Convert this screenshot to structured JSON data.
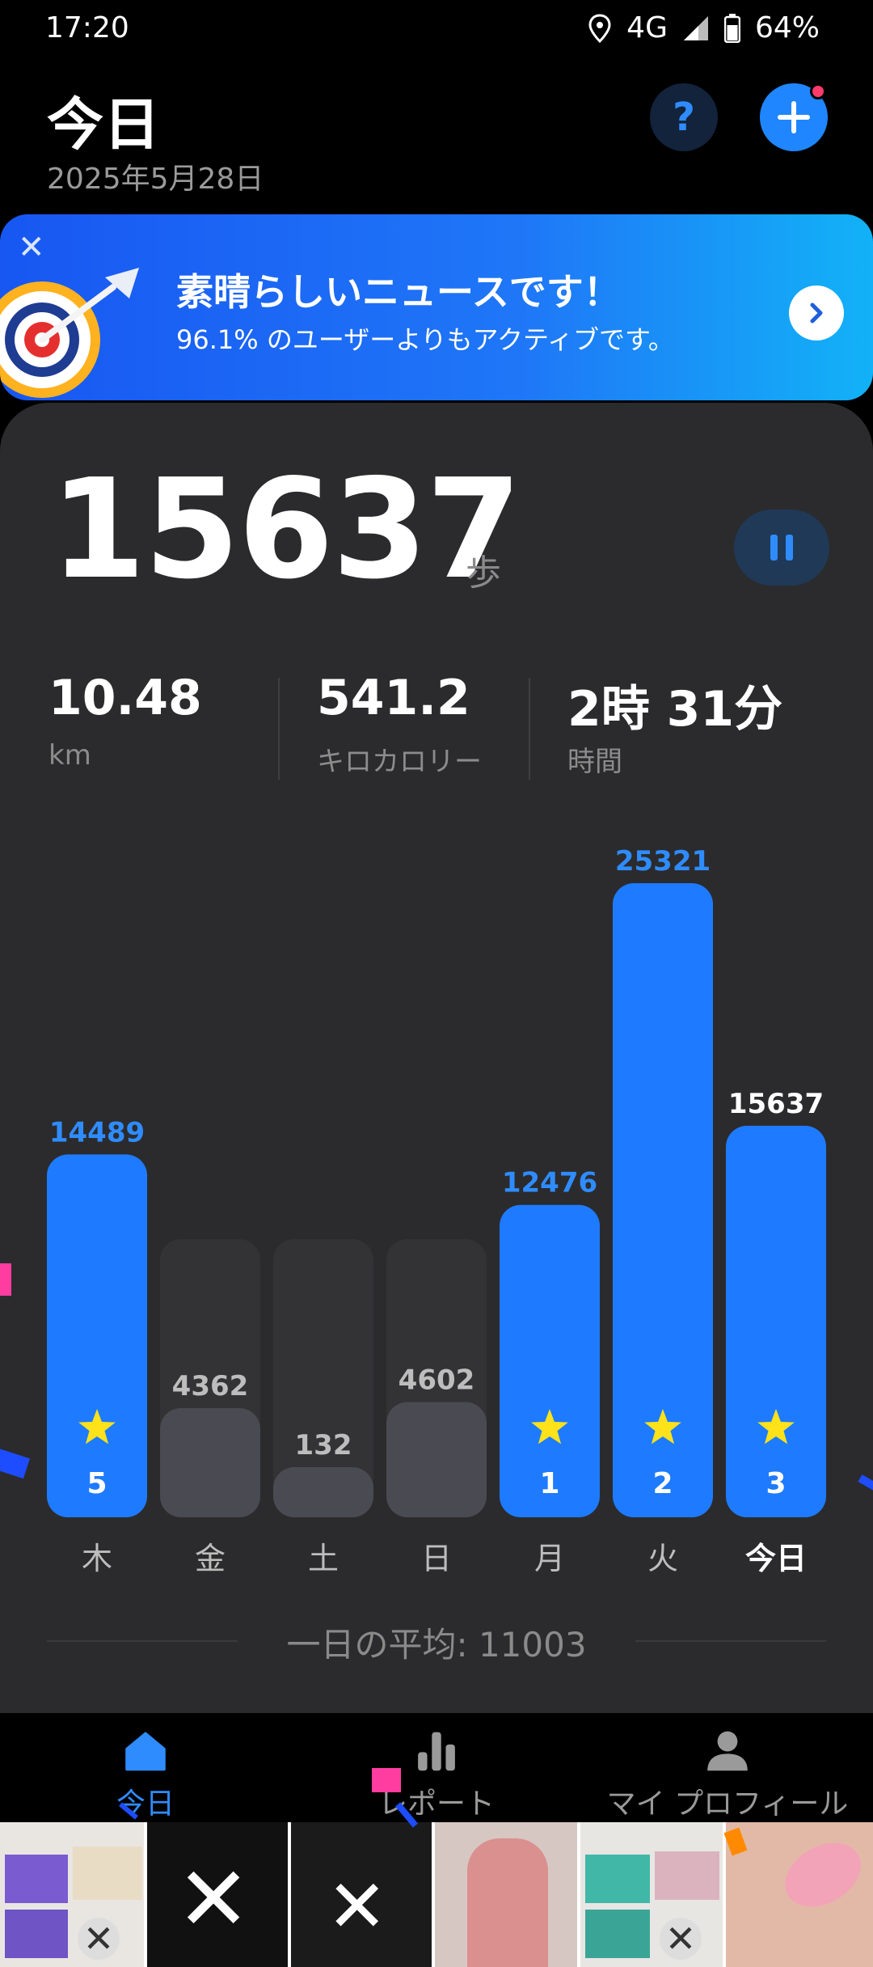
{
  "status_bar": {
    "time": "17:20",
    "network": "4G",
    "battery": "64%"
  },
  "header": {
    "title": "今日",
    "date": "2025年5月28日"
  },
  "banner": {
    "headline": "素晴らしいニュースです！",
    "subtext": "96.1% のユーザーよりもアクティブです。"
  },
  "summary": {
    "steps": "15637",
    "steps_unit": "歩",
    "stats": [
      {
        "value": "10.48",
        "label": "km"
      },
      {
        "value": "541.2",
        "label": "キロカロリー"
      },
      {
        "value": "2時 31分",
        "label": "時間"
      }
    ]
  },
  "chart_data": {
    "type": "bar",
    "categories": [
      "木",
      "金",
      "土",
      "日",
      "月",
      "火",
      "今日"
    ],
    "values": [
      14489,
      4362,
      132,
      4602,
      12476,
      25321,
      15637
    ],
    "goal_met": [
      true,
      false,
      false,
      false,
      true,
      true,
      true
    ],
    "star_counts": [
      "5",
      "",
      "",
      "",
      "1",
      "2",
      "3"
    ],
    "colors": {
      "achieved": "#1e7bff",
      "not_achieved": "#4a4a52",
      "track": "#333336",
      "label_achieved": "#2f8cff",
      "label_today": "#ffffff",
      "label_other": "#bdbdbd"
    }
  },
  "average": {
    "label": "一日の平均: 11003"
  },
  "nav": {
    "items": [
      {
        "label": "今日",
        "icon": "home-icon",
        "active": true
      },
      {
        "label": "レポート",
        "icon": "bar-chart-icon",
        "active": false
      },
      {
        "label": "マイ プロフィール",
        "icon": "profile-icon",
        "active": false
      }
    ]
  },
  "ads": {
    "images": [
      "bedding-purple",
      "hoodie-x",
      "hoodie-generation",
      "pink-loungewear",
      "bedding-teal",
      "eye-makeup-tool"
    ]
  },
  "colors": {
    "accent": "#1f86ff",
    "background": "#000000",
    "card": "#2b2b2d"
  }
}
